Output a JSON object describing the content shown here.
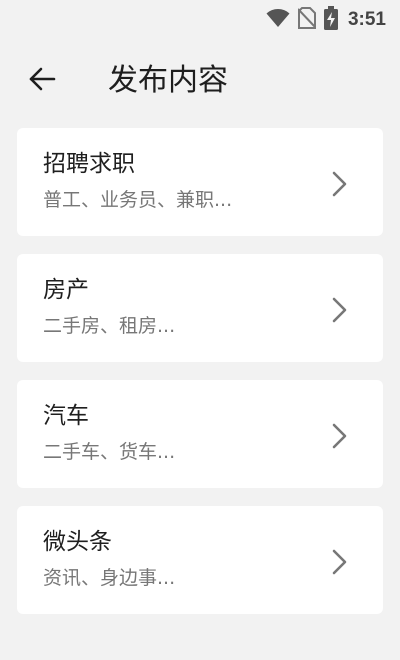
{
  "status_bar": {
    "time": "3:51",
    "icons": [
      "wifi-icon",
      "no-sim-icon",
      "battery-charging-icon"
    ]
  },
  "header": {
    "back_icon": "arrow-left-icon",
    "title": "发布内容"
  },
  "categories": [
    {
      "title": "招聘求职",
      "subtitle": "普工、业务员、兼职...",
      "icon": "chevron-right-icon"
    },
    {
      "title": "房产",
      "subtitle": "二手房、租房...",
      "icon": "chevron-right-icon"
    },
    {
      "title": "汽车",
      "subtitle": "二手车、货车...",
      "icon": "chevron-right-icon"
    },
    {
      "title": "微头条",
      "subtitle": "资讯、身边事...",
      "icon": "chevron-right-icon"
    }
  ],
  "colors": {
    "background": "#f2f2f2",
    "card": "#ffffff",
    "title_text": "#1f1f1f",
    "subtitle_text": "#777777"
  }
}
